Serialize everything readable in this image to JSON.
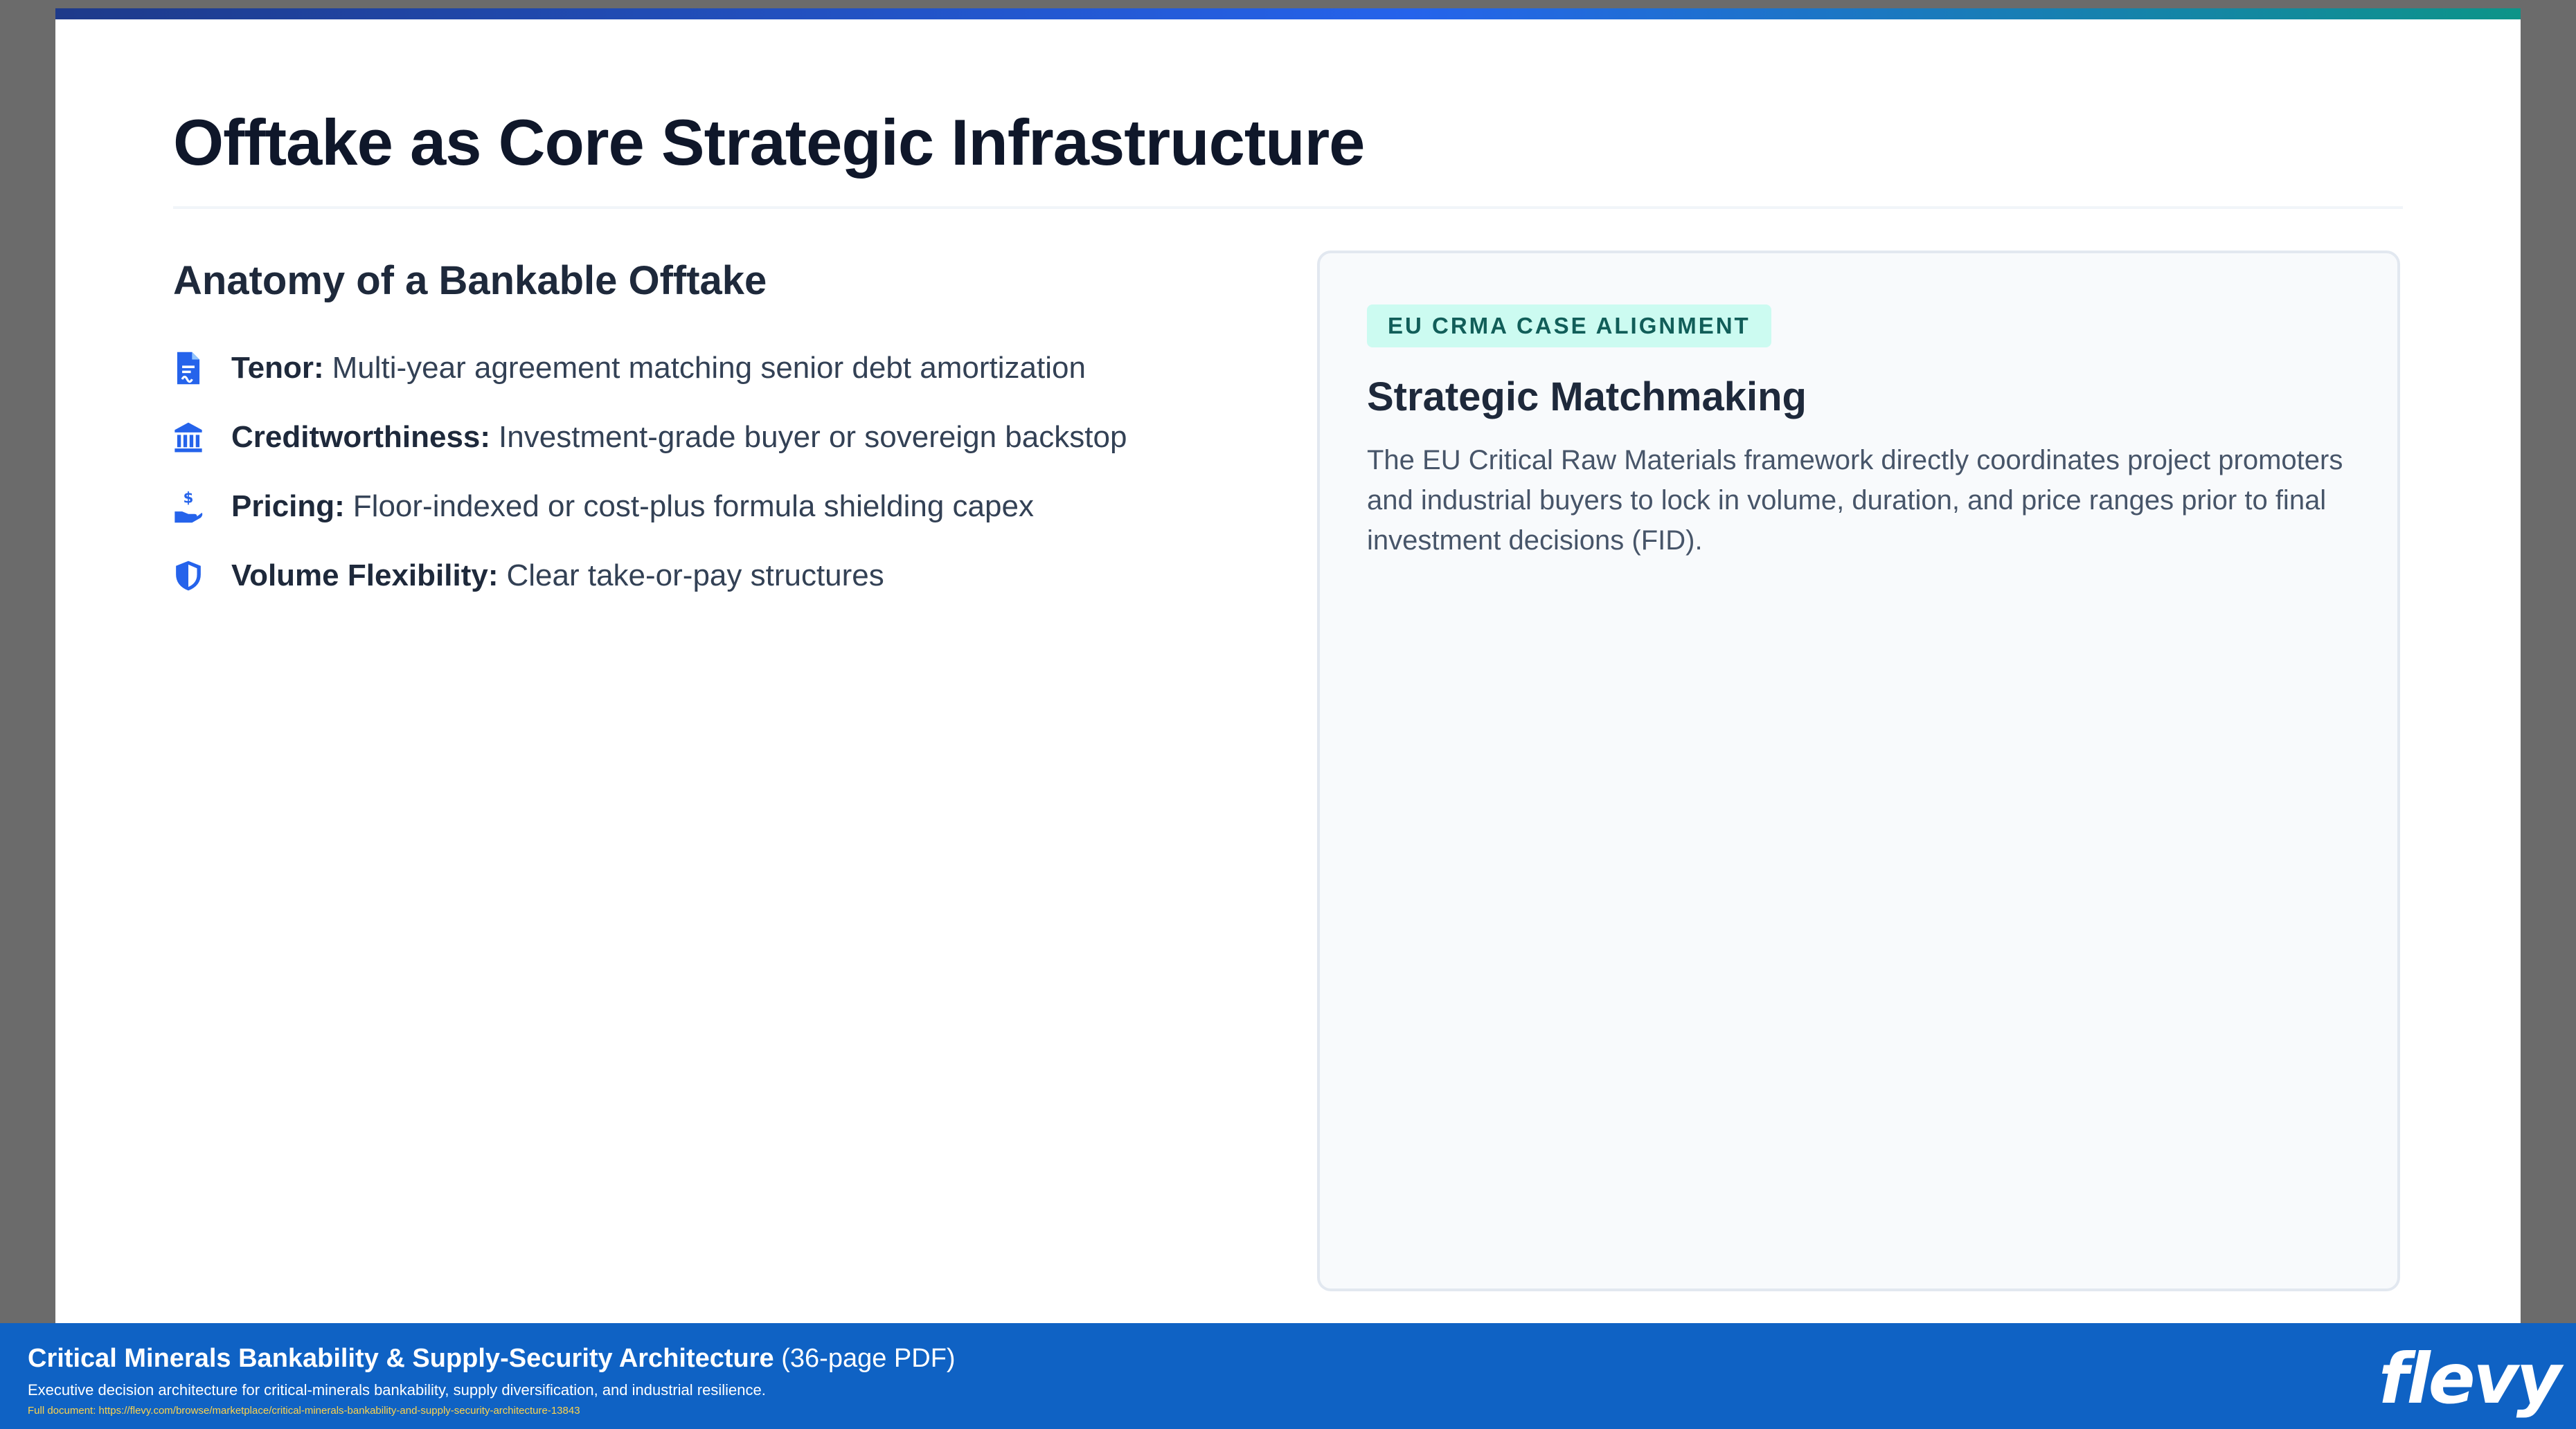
{
  "slide": {
    "title": "Offtake as Core Strategic Infrastructure",
    "left": {
      "heading": "Anatomy of a Bankable Offtake",
      "items": [
        {
          "icon": "contract-icon",
          "label": "Tenor:",
          "text": "Multi-year agreement matching senior debt amortization"
        },
        {
          "icon": "bank-icon",
          "label": "Creditworthiness:",
          "text": "Investment-grade buyer or sovereign backstop"
        },
        {
          "icon": "hand-dollar-icon",
          "label": "Pricing:",
          "text": "Floor-indexed or cost-plus formula shielding capex"
        },
        {
          "icon": "shield-icon",
          "label": "Volume Flexibility:",
          "text": "Clear take-or-pay structures"
        }
      ]
    },
    "card": {
      "badge": "EU CRMA CASE ALIGNMENT",
      "title": "Strategic Matchmaking",
      "body": "The EU Critical Raw Materials framework directly coordinates project promoters and industrial buyers to lock in volume, duration, and price ranges prior to final investment decisions (FID)."
    }
  },
  "footer": {
    "title": "Critical Minerals Bankability & Supply-Security Architecture",
    "pages": "(36-page PDF)",
    "subtitle": "Executive decision architecture for critical-minerals bankability, supply diversification, and industrial resilience.",
    "link": "Full document: https://flevy.com/browse/marketplace/critical-minerals-bankability-and-supply-security-architecture-13843",
    "logo": "flevy"
  },
  "colors": {
    "accent_icon": "#2563eb",
    "badge_bg": "#ccfbf1",
    "badge_text": "#115e59",
    "footer_bg": "#0f62c4"
  }
}
